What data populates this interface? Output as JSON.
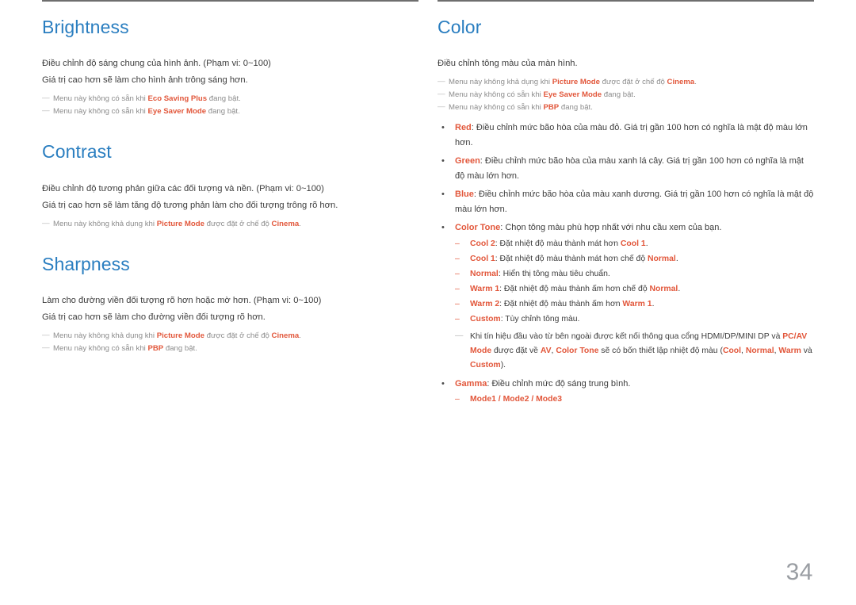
{
  "page": {
    "number": "34"
  },
  "left_column": {
    "sections": [
      {
        "title": "Brightness",
        "body": [
          "Điều chỉnh độ sáng chung của hình ảnh. (Phạm vi: 0~100)",
          "Giá trị cao hơn sẽ làm cho hình ảnh trông sáng hơn."
        ],
        "notes": [
          {
            "dash": "―",
            "pre": "Menu này không có sẵn khi ",
            "kw": "Eco Saving Plus",
            "post": " đang bật."
          },
          {
            "dash": "―",
            "pre": "Menu này không có sẵn khi ",
            "kw": "Eye Saver Mode",
            "post": " đang bật."
          }
        ]
      },
      {
        "title": "Contrast",
        "body": [
          "Điều chỉnh độ tương phản giữa các đối tượng và nền. (Phạm vi: 0~100)",
          "Giá trị cao hơn sẽ làm tăng độ tương phản làm cho đối tượng trông rõ hơn."
        ],
        "notes": [
          {
            "dash": "―",
            "pre": "Menu này không khả dụng khi ",
            "kw": "Picture Mode",
            "mid": " được đặt ở chế độ ",
            "kw2": "Cinema",
            "post": "."
          }
        ]
      },
      {
        "title": "Sharpness",
        "body": [
          "Làm cho đường viền đối tượng rõ hơn hoặc mờ hơn. (Phạm vi: 0~100)",
          "Giá trị cao hơn sẽ làm cho đường viền đối tượng rõ hơn."
        ],
        "notes": [
          {
            "dash": "―",
            "pre": "Menu này không khả dụng khi ",
            "kw": "Picture Mode",
            "mid": " được đặt ở chế độ ",
            "kw2": "Cinema",
            "post": "."
          },
          {
            "dash": "―",
            "pre": "Menu này không có sẵn khi ",
            "kw": "PBP",
            "post": " đang bật."
          }
        ]
      }
    ]
  },
  "right_column": {
    "title": "Color",
    "body": [
      "Điều chỉnh tông màu của màn hình."
    ],
    "notes": [
      {
        "dash": "―",
        "pre": "Menu này không khả dụng khi ",
        "kw": "Picture Mode",
        "mid": " được đặt ở chế độ ",
        "kw2": "Cinema",
        "post": "."
      },
      {
        "dash": "―",
        "pre": "Menu này không có sẵn khi ",
        "kw": "Eye Saver Mode",
        "post": " đang bật."
      },
      {
        "dash": "―",
        "pre": "Menu này không có sẵn khi ",
        "kw": "PBP",
        "post": " đang bật."
      }
    ],
    "bullets": [
      {
        "term": "Red",
        "text": ": Điều chỉnh mức bão hòa của màu đỏ. Giá trị gần 100 hơn có nghĩa là mật độ màu lớn hơn."
      },
      {
        "term": "Green",
        "text": ": Điều chỉnh mức bão hòa của màu xanh lá cây. Giá trị gần 100 hơn có nghĩa là mật độ màu lớn hơn."
      },
      {
        "term": "Blue",
        "text": ": Điều chỉnh mức bão hòa của màu xanh dương. Giá trị gần 100 hơn có nghĩa là mật độ màu lớn hơn."
      }
    ],
    "color_tone": {
      "term": "Color Tone",
      "text": ": Chọn tông màu phù hợp nhất với nhu cầu xem của bạn.",
      "options": [
        {
          "dash": "–",
          "term": "Cool 2",
          "pre": ": Đặt nhiệt độ màu thành mát hơn ",
          "kw": "Cool 1",
          "post": "."
        },
        {
          "dash": "–",
          "term": "Cool 1",
          "pre": ": Đặt nhiệt độ màu thành mát hơn chế độ ",
          "kw": "Normal",
          "post": "."
        },
        {
          "dash": "–",
          "term": "Normal",
          "pre": ": Hiển thị tông màu tiêu chuẩn.",
          "kw": "",
          "post": ""
        },
        {
          "dash": "–",
          "term": "Warm 1",
          "pre": ": Đặt nhiệt độ màu thành ấm hơn chế độ ",
          "kw": "Normal",
          "post": "."
        },
        {
          "dash": "–",
          "term": "Warm 2",
          "pre": ": Đặt nhiệt độ màu thành ấm hơn ",
          "kw": "Warm 1",
          "post": "."
        },
        {
          "dash": "–",
          "term": "Custom",
          "pre": ": Tùy chỉnh tông màu.",
          "kw": "",
          "post": ""
        }
      ],
      "footnote": {
        "dash": "―",
        "p1": "Khi tín hiệu đầu vào từ bên ngoài được kết nối thông qua cổng HDMI/DP/MINI DP và ",
        "kw1": "PC/AV Mode",
        "p2": " được đặt về ",
        "kw2": "AV",
        "p3": ", ",
        "kw3": "Color Tone",
        "p4": " sẽ có bốn thiết lập nhiệt độ màu (",
        "kw4": "Cool",
        "p5": ", ",
        "kw5": "Normal",
        "p6": ", ",
        "kw6": "Warm",
        "p7": " và ",
        "kw7": "Custom",
        "p8": ")."
      }
    },
    "gamma": {
      "term": "Gamma",
      "text": ": Điều chỉnh mức độ sáng trung bình.",
      "modes": {
        "dash": "–",
        "value": "Mode1 / Mode2 / Mode3"
      }
    }
  },
  "colors": {
    "heading_blue": "#2a7ec0",
    "keyword_red": "#e2573b",
    "body_gray": "#3c3c3c",
    "note_gray": "#8c8c8c",
    "rule_gray": "#6e6e6e",
    "page_number_gray": "#9a9ea3"
  }
}
